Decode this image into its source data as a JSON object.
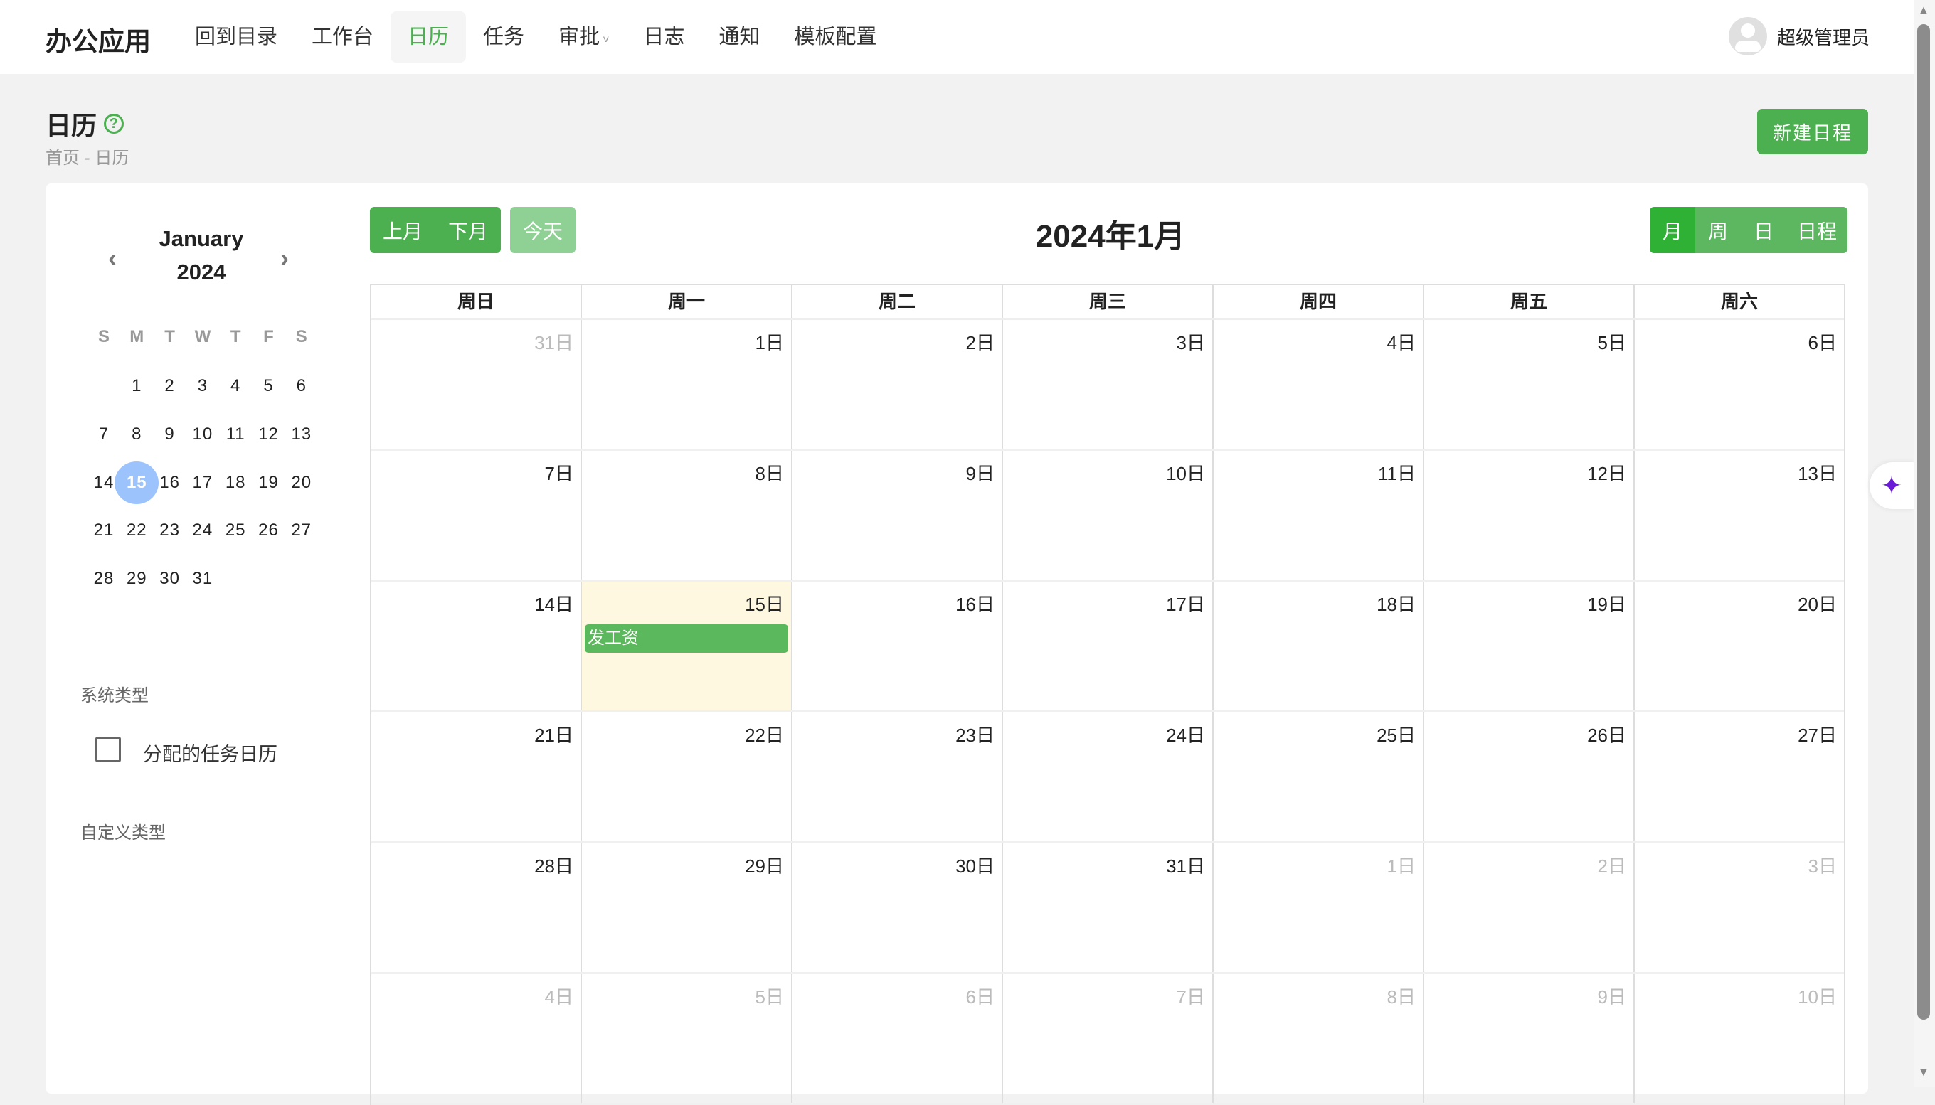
{
  "header": {
    "logo": "办公应用",
    "nav": [
      {
        "label": "回到目录"
      },
      {
        "label": "工作台"
      },
      {
        "label": "日历",
        "active": true
      },
      {
        "label": "任务"
      },
      {
        "label": "审批",
        "dropdown": true
      },
      {
        "label": "日志"
      },
      {
        "label": "通知"
      },
      {
        "label": "模板配置"
      }
    ],
    "user": "超级管理员"
  },
  "page": {
    "title": "日历",
    "breadcrumb": "首页 - 日历",
    "new_button": "新建日程"
  },
  "mini_calendar": {
    "month": "January",
    "year": "2024",
    "weekdays": [
      "S",
      "M",
      "T",
      "W",
      "T",
      "F",
      "S"
    ],
    "first_weekday": 1,
    "days_in_month": 31,
    "selected": 15
  },
  "filters": {
    "system_label": "系统类型",
    "system_items": [
      {
        "label": "分配的任务日历",
        "checked": false
      }
    ],
    "custom_label": "自定义类型"
  },
  "toolbar": {
    "prev": "上月",
    "next": "下月",
    "today": "今天",
    "title": "2024年1月",
    "views": [
      "月",
      "周",
      "日",
      "日程"
    ],
    "active_view": "月"
  },
  "calendar": {
    "weekdays": [
      "周日",
      "周一",
      "周二",
      "周三",
      "周四",
      "周五",
      "周六"
    ],
    "weeks": [
      [
        {
          "d": "31日",
          "m": true
        },
        {
          "d": "1日"
        },
        {
          "d": "2日"
        },
        {
          "d": "3日"
        },
        {
          "d": "4日"
        },
        {
          "d": "5日"
        },
        {
          "d": "6日"
        }
      ],
      [
        {
          "d": "7日"
        },
        {
          "d": "8日"
        },
        {
          "d": "9日"
        },
        {
          "d": "10日"
        },
        {
          "d": "11日"
        },
        {
          "d": "12日"
        },
        {
          "d": "13日"
        }
      ],
      [
        {
          "d": "14日"
        },
        {
          "d": "15日",
          "today": true,
          "events": [
            "发工资"
          ]
        },
        {
          "d": "16日"
        },
        {
          "d": "17日"
        },
        {
          "d": "18日"
        },
        {
          "d": "19日"
        },
        {
          "d": "20日"
        }
      ],
      [
        {
          "d": "21日"
        },
        {
          "d": "22日"
        },
        {
          "d": "23日"
        },
        {
          "d": "24日"
        },
        {
          "d": "25日"
        },
        {
          "d": "26日"
        },
        {
          "d": "27日"
        }
      ],
      [
        {
          "d": "28日"
        },
        {
          "d": "29日"
        },
        {
          "d": "30日"
        },
        {
          "d": "31日"
        },
        {
          "d": "1日",
          "m": true
        },
        {
          "d": "2日",
          "m": true
        },
        {
          "d": "3日",
          "m": true
        }
      ],
      [
        {
          "d": "4日",
          "m": true
        },
        {
          "d": "5日",
          "m": true
        },
        {
          "d": "6日",
          "m": true
        },
        {
          "d": "7日",
          "m": true
        },
        {
          "d": "8日",
          "m": true
        },
        {
          "d": "9日",
          "m": true
        },
        {
          "d": "10日",
          "m": true
        }
      ]
    ]
  },
  "colors": {
    "accent": "#4caf50",
    "today_bg": "#fff8e1",
    "selected_day": "#9dc3fd",
    "event": "#5cb85c"
  },
  "icons": {
    "help": "question-circle-icon",
    "ai": "sparkles-icon",
    "avatar": "user-avatar-icon"
  }
}
